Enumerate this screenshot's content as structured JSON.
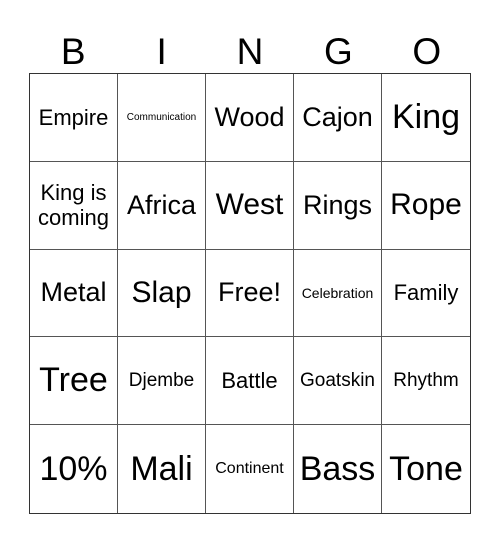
{
  "title_letters": [
    "B",
    "I",
    "N",
    "G",
    "O"
  ],
  "rows": [
    [
      {
        "text": "Empire",
        "size": "s-ms"
      },
      {
        "text": "Communication",
        "size": "s-tiny"
      },
      {
        "text": "Wood",
        "size": "s-m"
      },
      {
        "text": "Cajon",
        "size": "s-m"
      },
      {
        "text": "King",
        "size": "s-xl"
      }
    ],
    [
      {
        "text": "King is coming",
        "size": "s-ms"
      },
      {
        "text": "Africa",
        "size": "s-m"
      },
      {
        "text": "West",
        "size": "s-l"
      },
      {
        "text": "Rings",
        "size": "s-m"
      },
      {
        "text": "Rope",
        "size": "s-l"
      }
    ],
    [
      {
        "text": "Metal",
        "size": "s-m"
      },
      {
        "text": "Slap",
        "size": "s-l"
      },
      {
        "text": "Free!",
        "size": "s-m"
      },
      {
        "text": "Celebration",
        "size": "s-xxs"
      },
      {
        "text": "Family",
        "size": "s-ms"
      }
    ],
    [
      {
        "text": "Tree",
        "size": "s-xl"
      },
      {
        "text": "Djembe",
        "size": "s-s"
      },
      {
        "text": "Battle",
        "size": "s-ms"
      },
      {
        "text": "Goatskin",
        "size": "s-s"
      },
      {
        "text": "Rhythm",
        "size": "s-s"
      }
    ],
    [
      {
        "text": "10%",
        "size": "s-xl"
      },
      {
        "text": "Mali",
        "size": "s-xl"
      },
      {
        "text": "Continent",
        "size": "s-xs"
      },
      {
        "text": "Bass",
        "size": "s-xl"
      },
      {
        "text": "Tone",
        "size": "s-xl"
      }
    ]
  ]
}
